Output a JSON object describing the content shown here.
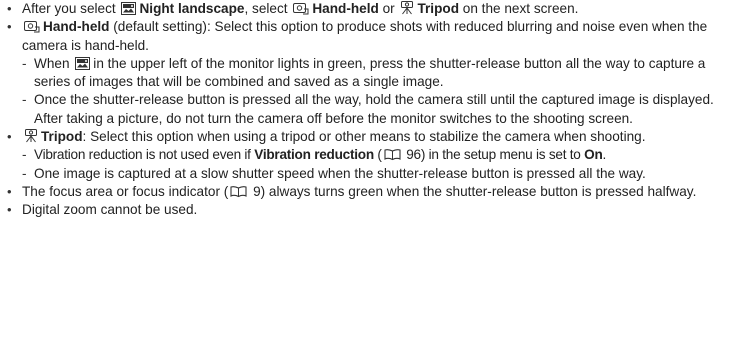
{
  "bullets": {
    "b1": {
      "t1": "After you select",
      "bold1": "Night landscape",
      "t2": ", select",
      "bold2": "Hand-held",
      "t3": "or",
      "bold3": "Tripod",
      "t4": "on the next screen.",
      "icon1": "night-landscape-icon",
      "icon2": "hand-held-icon",
      "icon3": "tripod-icon"
    },
    "b2": {
      "bold": "Hand-held",
      "text": "(default setting): Select this option to produce shots with reduced blurring and noise even when the camera is hand-held.",
      "icon": "hand-held-icon",
      "sub1": {
        "t1": "When",
        "t2": "in the upper left of the monitor lights in green, press the shutter-release button all the way to capture a series of images that will be combined and saved as a single image.",
        "icon": "night-landscape-icon"
      },
      "sub2": "Once the shutter-release button is pressed all the way, hold the camera still until the captured image is displayed. After taking a picture, do not turn the camera off before the monitor switches to the shooting screen."
    },
    "b3": {
      "bold": "Tripod",
      "text": ": Select this option when using a tripod or other means to stabilize the camera when shooting.",
      "icon": "tripod-icon",
      "sub1": {
        "t1": "Vibration reduction is not used even if",
        "bold": "Vibration reduction",
        "ref": "96",
        "t2": ") in the setup menu is set to",
        "bold2": "On",
        "t3": ".",
        "icon": "book-ref-icon"
      },
      "sub2": "One image is captured at a slow shutter speed when the shutter-release button is pressed all the way."
    },
    "b4": {
      "t1": "The focus area or focus indicator (",
      "ref": "9",
      "t2": ") always turns green when the shutter-release button is pressed halfway.",
      "icon": "book-ref-icon"
    },
    "b5": "Digital zoom cannot be used."
  }
}
